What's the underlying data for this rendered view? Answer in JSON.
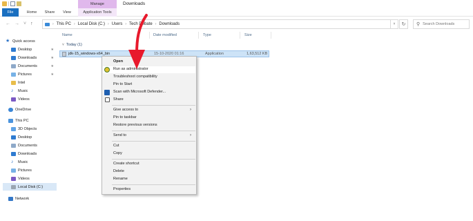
{
  "titlebar": {
    "manage_label": "Manage",
    "window_title": "Downloads"
  },
  "ribbon": {
    "tabs": [
      "File",
      "Home",
      "Share",
      "View",
      "Application Tools"
    ]
  },
  "address": {
    "path": [
      "This PC",
      "Local Disk (C:)",
      "Users",
      "Tech Debate",
      "Downloads"
    ],
    "search_placeholder": "Search Downloads"
  },
  "sidebar": {
    "items": [
      {
        "label": "Quick access",
        "icon": "star-icon"
      },
      {
        "label": "Desktop",
        "icon": "desktop-icon",
        "pinned": true
      },
      {
        "label": "Downloads",
        "icon": "download-icon",
        "pinned": true
      },
      {
        "label": "Documents",
        "icon": "documents-icon",
        "pinned": true
      },
      {
        "label": "Pictures",
        "icon": "pictures-icon",
        "pinned": true
      },
      {
        "label": "Intel",
        "icon": "folder-icon"
      },
      {
        "label": "Music",
        "icon": "music-icon"
      },
      {
        "label": "Videos",
        "icon": "videos-icon"
      },
      {
        "label": "OneDrive",
        "icon": "onedrive-icon"
      },
      {
        "label": "This PC",
        "icon": "pc-icon"
      },
      {
        "label": "3D Objects",
        "icon": "3d-objects-icon"
      },
      {
        "label": "Desktop",
        "icon": "desktop-icon"
      },
      {
        "label": "Documents",
        "icon": "documents-icon"
      },
      {
        "label": "Downloads",
        "icon": "download-icon"
      },
      {
        "label": "Music",
        "icon": "music-icon"
      },
      {
        "label": "Pictures",
        "icon": "pictures-icon"
      },
      {
        "label": "Videos",
        "icon": "videos-icon"
      },
      {
        "label": "Local Disk (C:)",
        "icon": "disk-icon",
        "selected": true
      },
      {
        "label": "Network",
        "icon": "network-icon"
      }
    ],
    "pin_glyph": "★"
  },
  "columns": {
    "name": "Name",
    "date": "Date modified",
    "type": "Type",
    "size": "Size"
  },
  "group": {
    "label": "Today (1)"
  },
  "file": {
    "name": "jdk-15_windows-x64_bin",
    "date": "15-10-2020 01:16",
    "type": "Application",
    "size": "1,63,512 KB"
  },
  "context_menu": {
    "items": [
      {
        "label": "Open",
        "bold": true
      },
      {
        "label": "Run as administrator",
        "icon": "uac-shield-icon"
      },
      {
        "label": "Troubleshoot compatibility"
      },
      {
        "label": "Pin to Start"
      },
      {
        "label": "Scan with Microsoft Defender...",
        "icon": "defender-icon"
      },
      {
        "label": "Share",
        "icon": "share-icon"
      },
      {
        "label": "Give access to",
        "submenu": true
      },
      {
        "label": "Pin to taskbar"
      },
      {
        "label": "Restore previous versions"
      },
      {
        "label": "Send to",
        "submenu": true
      },
      {
        "label": "Cut"
      },
      {
        "label": "Copy"
      },
      {
        "label": "Create shortcut"
      },
      {
        "label": "Delete"
      },
      {
        "label": "Rename"
      },
      {
        "label": "Properties"
      }
    ]
  },
  "colors": {
    "accent": "#1a6fc0",
    "selection": "#cde3f7",
    "annotation_arrow": "#e8192c",
    "manage_tab": "#e0b8ec"
  }
}
